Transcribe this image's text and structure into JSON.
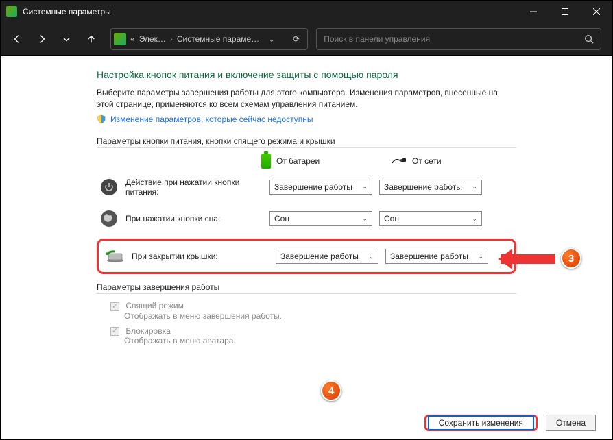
{
  "titlebar": {
    "title": "Системные параметры"
  },
  "nav": {
    "crumb1": "Элек…",
    "crumb2": "Системные параме…",
    "search_placeholder": "Поиск в панели управления"
  },
  "page": {
    "heading": "Настройка кнопок питания и включение защиты с помощью пароля",
    "intro": "Выберите параметры завершения работы для этого компьютера. Изменения параметров, внесенные на этой странице, применяются ко всем схемам управления питанием.",
    "change_link": "Изменение параметров, которые сейчас недоступны",
    "section1": "Параметры кнопки питания, кнопки спящего режима и крышки",
    "col_battery": "От батареи",
    "col_plugged": "От сети",
    "rows": [
      {
        "label": "Действие при нажатии кнопки питания:",
        "battery": "Завершение работы",
        "plugged": "Завершение работы"
      },
      {
        "label": "При нажатии кнопки сна:",
        "battery": "Сон",
        "plugged": "Сон"
      },
      {
        "label": "При закрытии крышки:",
        "battery": "Завершение работы",
        "plugged": "Завершение работы"
      }
    ],
    "section2": "Параметры завершения работы",
    "checks": [
      {
        "title": "Спящий режим",
        "desc": "Отображать в меню завершения работы."
      },
      {
        "title": "Блокировка",
        "desc": "Отображать в меню аватара."
      }
    ],
    "save": "Сохранить изменения",
    "cancel": "Отмена"
  },
  "annotations": {
    "b3": "3",
    "b4": "4"
  }
}
